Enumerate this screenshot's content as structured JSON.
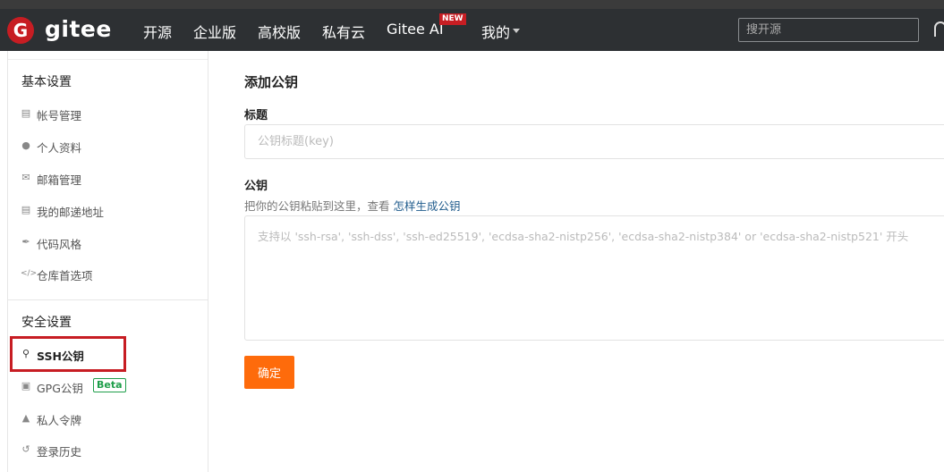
{
  "nav": {
    "logo_letter": "G",
    "brand": "gitee",
    "items": [
      "开源",
      "企业版",
      "高校版",
      "私有云",
      "Gitee AI",
      "我的"
    ],
    "new_badge": "NEW",
    "search_placeholder": "搜开源"
  },
  "sidebar": {
    "basic_header": "基本设置",
    "basic_items": [
      {
        "label": "帐号管理",
        "icon": "id-card-icon"
      },
      {
        "label": "个人资料",
        "icon": "user-icon"
      },
      {
        "label": "邮箱管理",
        "icon": "envelope-icon"
      },
      {
        "label": "我的邮递地址",
        "icon": "address-card-icon"
      },
      {
        "label": "代码风格",
        "icon": "brush-icon"
      },
      {
        "label": "仓库首选项",
        "icon": "code-icon"
      }
    ],
    "security_header": "安全设置",
    "security_items": [
      {
        "label": "SSH公钥",
        "icon": "key-icon",
        "active": true
      },
      {
        "label": "GPG公钥",
        "icon": "lock-icon",
        "badge": "Beta"
      },
      {
        "label": "私人令牌",
        "icon": "user-secret-icon"
      },
      {
        "label": "登录历史",
        "icon": "history-icon"
      }
    ]
  },
  "main": {
    "title": "添加公钥",
    "title_label": "标题",
    "title_placeholder": "公钥标题(key)",
    "key_label": "公钥",
    "help_text": "把你的公钥粘贴到这里，查看 ",
    "help_link": "怎样生成公钥",
    "key_placeholder": "支持以 'ssh-rsa', 'ssh-dss', 'ssh-ed25519', 'ecdsa-sha2-nistp256', 'ecdsa-sha2-nistp384' or 'ecdsa-sha2-nistp521' 开头",
    "submit_label": "确定"
  },
  "colors": {
    "navbar": "#2d3033",
    "brand_red": "#c71d23",
    "submit_orange": "#fe6b0b",
    "link_blue": "#1f5b8c",
    "beta_green": "#1e9e4a"
  }
}
